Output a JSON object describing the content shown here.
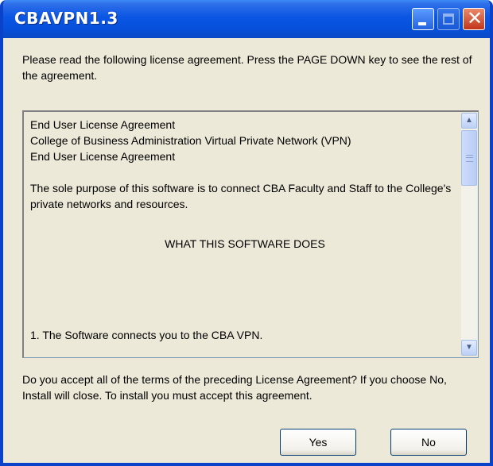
{
  "window": {
    "title": "CBAVPN1.3",
    "controls": {
      "minimize_icon": "minimize-icon",
      "maximize_icon": "maximize-icon",
      "close_icon": "close-icon"
    }
  },
  "intro_text": "Please read the following license agreement. Press the PAGE DOWN key to see the rest of the agreement.",
  "license": {
    "lines": [
      "End User License Agreement",
      "College of Business Administration Virtual Private Network (VPN)",
      "End User License Agreement"
    ],
    "paragraph": "The sole purpose of this software is to connect CBA Faculty and Staff to the College's private networks and resources.",
    "heading": "WHAT THIS SOFTWARE DOES",
    "item_1": "1. The Software connects you to the CBA VPN."
  },
  "question_text": "Do you accept all of the terms of the preceding License Agreement? If you choose No, Install will close. To install you must accept this agreement.",
  "buttons": {
    "yes": "Yes",
    "no": "No"
  },
  "colors": {
    "titlebar": "#0a56e3",
    "dialog_bg": "#ece9d8",
    "border": "#0a42c9"
  }
}
